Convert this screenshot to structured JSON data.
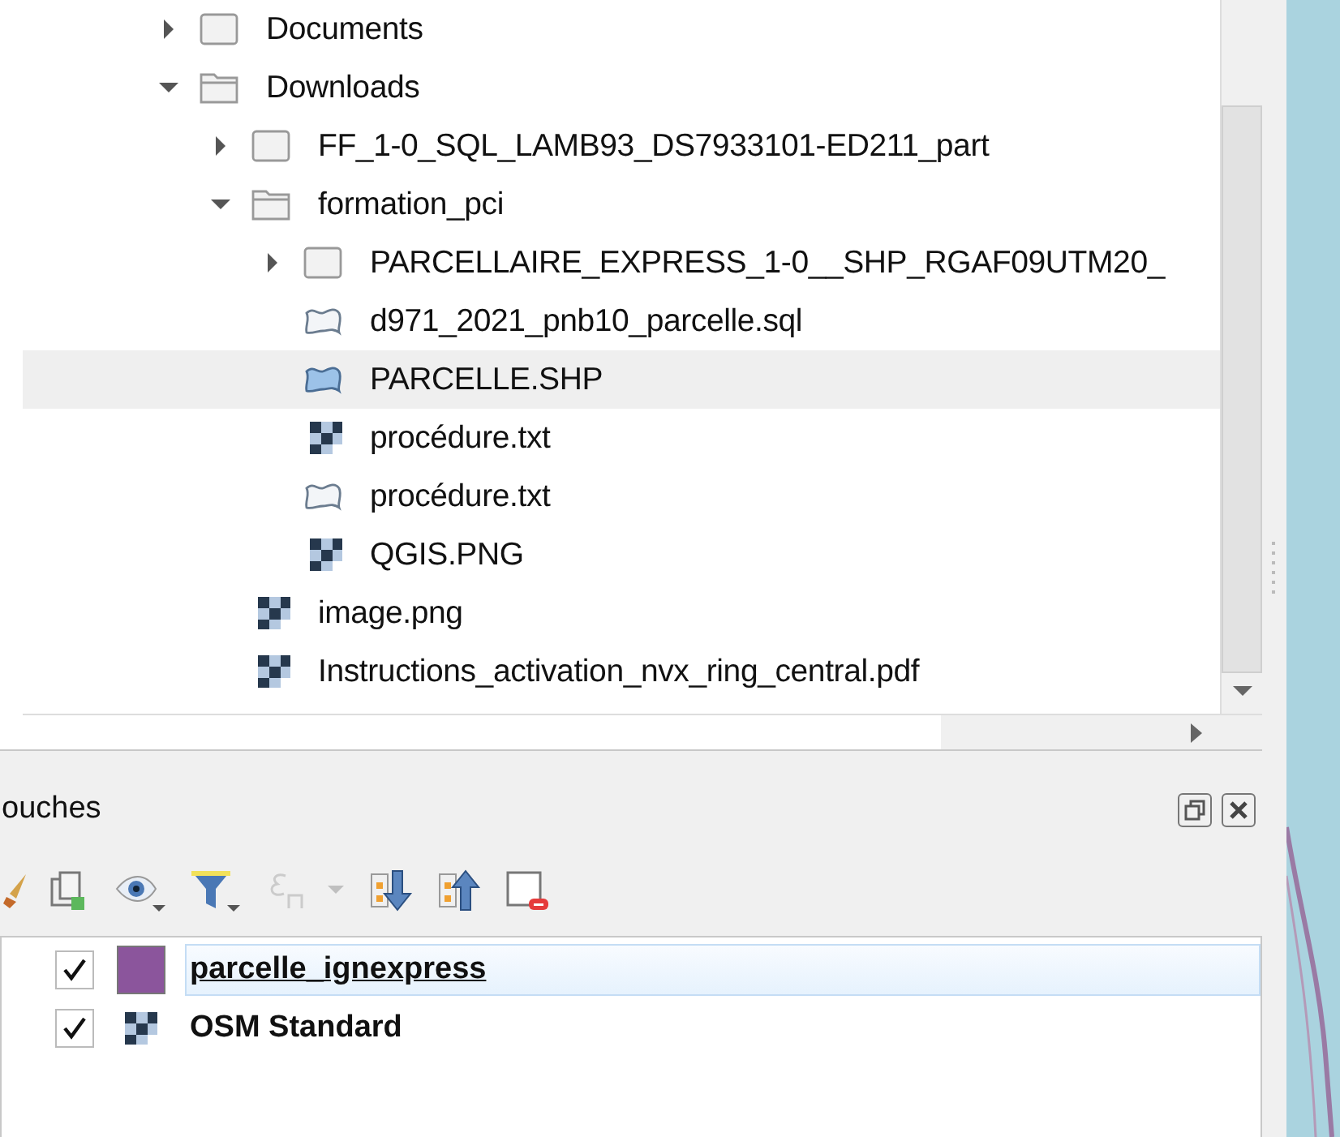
{
  "browser": {
    "tree": [
      {
        "label": "Documents",
        "kind": "folder",
        "expanded": false,
        "selected": false
      },
      {
        "label": "Downloads",
        "kind": "folder",
        "expanded": true,
        "selected": false,
        "children": [
          {
            "label": "FF_1-0_SQL_LAMB93_DS7933101-ED211_part",
            "kind": "folder",
            "expanded": false,
            "selected": false
          },
          {
            "label": "formation_pci",
            "kind": "folder",
            "expanded": true,
            "selected": false,
            "children": [
              {
                "label": "PARCELLAIRE_EXPRESS_1-0__SHP_RGAF09UTM20_",
                "kind": "folder",
                "expanded": false,
                "selected": false
              },
              {
                "label": "d971_2021_pnb10_parcelle.sql",
                "kind": "vector",
                "selected": false
              },
              {
                "label": "PARCELLE.SHP",
                "kind": "vector",
                "selected": true
              },
              {
                "label": "procédure.txt",
                "kind": "raster",
                "selected": false
              },
              {
                "label": "procédure.txt",
                "kind": "vector",
                "selected": false
              },
              {
                "label": "QGIS.PNG",
                "kind": "raster",
                "selected": false
              }
            ]
          },
          {
            "label": "image.png",
            "kind": "raster",
            "selected": false
          },
          {
            "label": "Instructions_activation_nvx_ring_central.pdf",
            "kind": "raster",
            "selected": false
          }
        ]
      }
    ]
  },
  "layers_panel": {
    "title": "ouches",
    "toolbar": [
      {
        "kind": "brush",
        "disabled": false
      },
      {
        "kind": "add-group",
        "disabled": false
      },
      {
        "kind": "eye",
        "disabled": false
      },
      {
        "kind": "filter",
        "disabled": false
      },
      {
        "kind": "expression",
        "disabled": true
      },
      {
        "kind": "expand",
        "disabled": false
      },
      {
        "kind": "collapse",
        "disabled": false
      },
      {
        "kind": "remove",
        "disabled": false
      }
    ],
    "layers": [
      {
        "name": "parcelle_ignexpress",
        "checked": true,
        "kind": "vector",
        "color": "#8b559c",
        "selected": true
      },
      {
        "name": "OSM Standard",
        "checked": true,
        "kind": "raster",
        "selected": false
      }
    ]
  }
}
